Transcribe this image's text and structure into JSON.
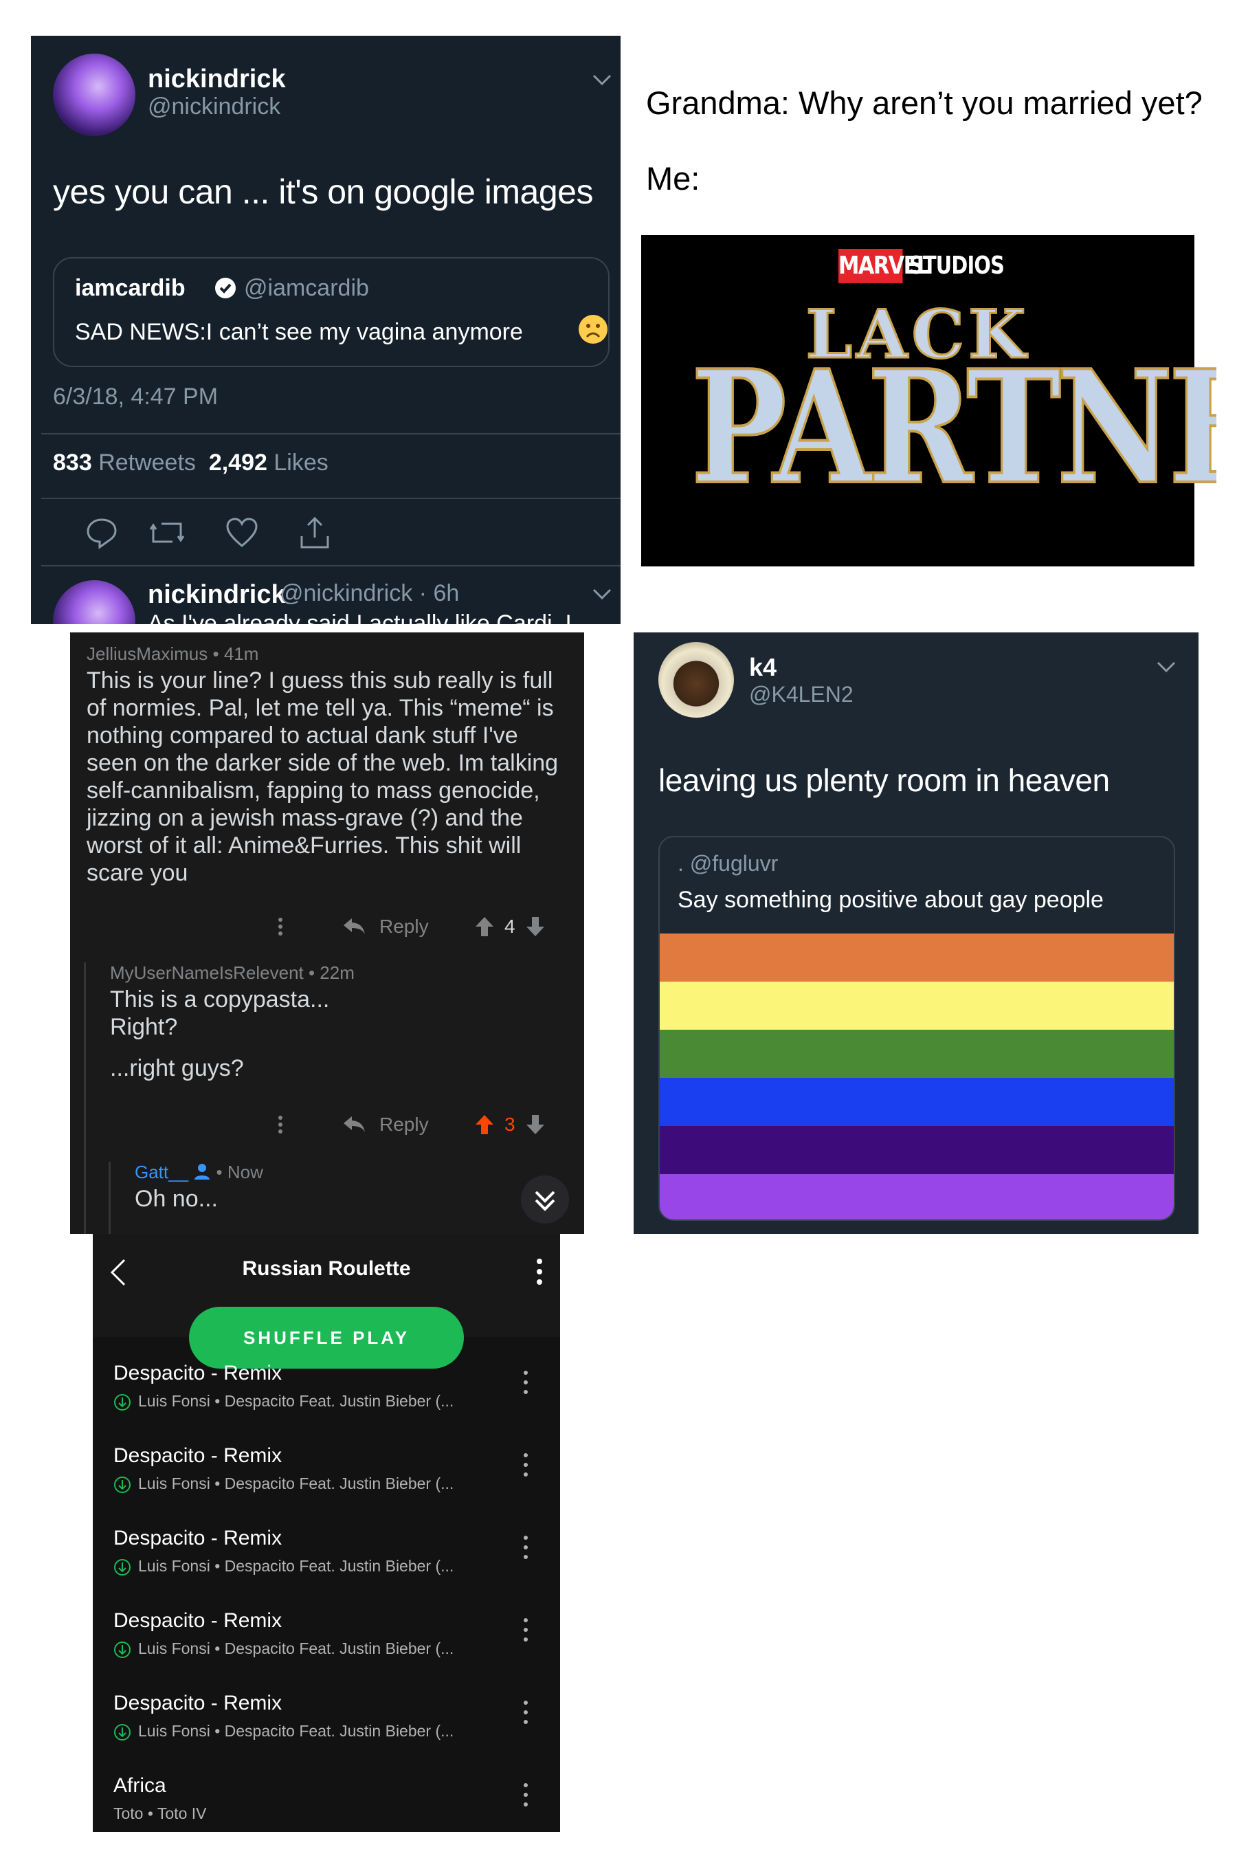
{
  "tweet1": {
    "display_name": "nickindrick",
    "handle": "@nickindrick",
    "body": "yes you can ... it's on google images",
    "quoted": {
      "display_name": "iamcardib",
      "handle": "@iamcardib",
      "text": "SAD NEWS:I can’t see my vagina anymore",
      "emoji": "☹"
    },
    "date": "6/3/18, 4:47 PM",
    "retweets_count": "833",
    "retweets_label": "Retweets",
    "likes_count": "2,492",
    "likes_label": "Likes",
    "icons": [
      "reply-icon",
      "retweet-icon",
      "like-icon",
      "share-icon"
    ],
    "next_reply": {
      "display_name": "nickindrick",
      "handle_time": "@nickindrick · 6h",
      "text_fragment": "As I've already said I actually like Cardi, I"
    }
  },
  "grandma_meme": {
    "line1": "Grandma: Why aren’t you married yet?",
    "line2": "Me:",
    "poster": {
      "brand": "MARVEL",
      "studio": "STUDIOS",
      "title_top": "LACK",
      "title_bottom": "PARTNER"
    }
  },
  "reddit": {
    "comment1": {
      "user": "JelliusMaximus",
      "time": "• 41m",
      "text": "This is your line? I guess this sub really is full of normies. Pal, let me tell ya. This “meme“ is nothing compared to actual dank stuff I've seen on the darker side of the web. Im talking self-cannibalism, fapping to mass genocide, jizzing on a jewish mass-grave (?) and the worst of it all: Anime&Furries. This shit will scare you",
      "reply_label": "Reply",
      "score": "4"
    },
    "comment2": {
      "user": "MyUserNameIsRelevent",
      "time": "• 22m",
      "text_lines": [
        "This is a copypasta...",
        "Right?",
        "",
        "...right guys?"
      ],
      "reply_label": "Reply",
      "score": "3",
      "upvoted_color": "#ff4500"
    },
    "comment3": {
      "user": "Gatt__",
      "time": "• Now",
      "text": "Oh no...",
      "user_color": "#3794ff"
    }
  },
  "k4_tweet": {
    "display_name": "k4",
    "handle": "@K4LEN2",
    "body": "leaving us plenty room in heaven",
    "quoted": {
      "handle": ". @fugluvr",
      "text": "Say something positive about gay people"
    },
    "flag_colors": [
      "#e07a3f",
      "#fbf57a",
      "#4b8a34",
      "#1a3ff0",
      "#3d0c7a",
      "#9946e8"
    ]
  },
  "spotify": {
    "playlist_title": "Russian Roulette",
    "shuffle_label": "SHUFFLE PLAY",
    "accent_color": "#1db954",
    "tracks": [
      {
        "name": "Despacito - Remix",
        "sub": "Luis Fonsi • Despacito Feat. Justin Bieber (..."
      },
      {
        "name": "Despacito - Remix",
        "sub": "Luis Fonsi • Despacito Feat. Justin Bieber (..."
      },
      {
        "name": "Despacito - Remix",
        "sub": "Luis Fonsi • Despacito Feat. Justin Bieber (..."
      },
      {
        "name": "Despacito - Remix",
        "sub": "Luis Fonsi • Despacito Feat. Justin Bieber (..."
      },
      {
        "name": "Despacito - Remix",
        "sub": "Luis Fonsi • Despacito Feat. Justin Bieber (..."
      },
      {
        "name": "Africa",
        "sub": "Toto • Toto IV"
      }
    ]
  }
}
